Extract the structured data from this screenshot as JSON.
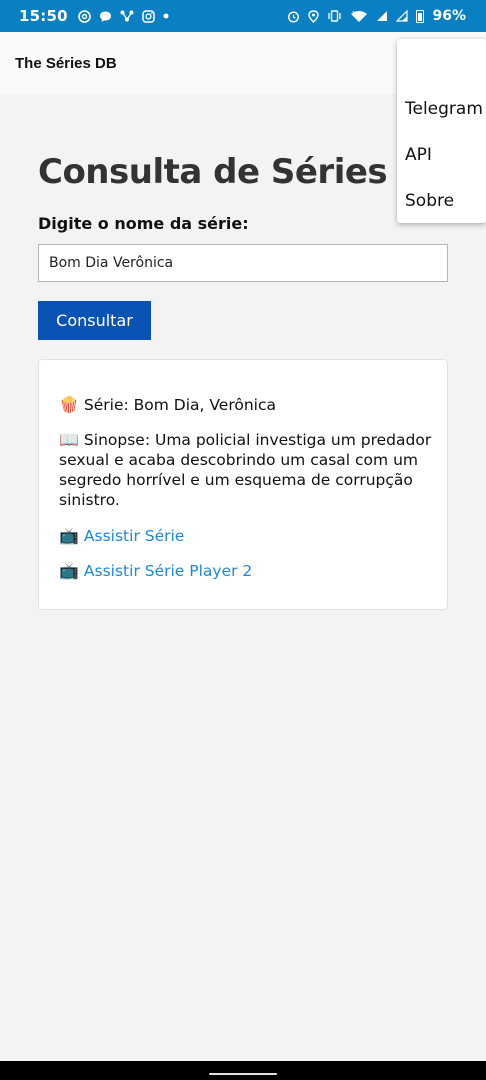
{
  "status_bar": {
    "time": "15:50",
    "battery_percent": "96%",
    "left_icons": [
      "threads-icon",
      "chat-icon",
      "network-icon",
      "instagram-icon",
      "dot-icon"
    ],
    "right_icons": [
      "alarm-icon",
      "location-icon",
      "vibrate-icon",
      "wifi-icon",
      "signal-icon",
      "signal-icon",
      "battery-icon"
    ],
    "background_color": "#0a7fc2"
  },
  "header": {
    "title": "The Séries DB"
  },
  "menu": {
    "items": [
      {
        "label": "Telegram"
      },
      {
        "label": "API"
      },
      {
        "label": "Sobre"
      }
    ]
  },
  "main": {
    "heading": "Consulta de Séries",
    "field_label": "Digite o nome da série:",
    "search_value": "Bom Dia Verônica",
    "button_label": "Consultar",
    "button_color": "#0a52b3"
  },
  "result": {
    "serie_emoji": "🍿",
    "serie_text": "Série: Bom Dia, Verônica",
    "sinopse_emoji": "📖",
    "sinopse_text": "Sinopse: Uma policial investiga um predador sexual e acaba descobrindo um casal com um segredo horrível e um esquema de corrupção sinistro.",
    "link_emoji": "📺",
    "link1_text": "Assistir Série",
    "link2_text": "Assistir Série Player 2",
    "link_color": "#1e88d6"
  }
}
